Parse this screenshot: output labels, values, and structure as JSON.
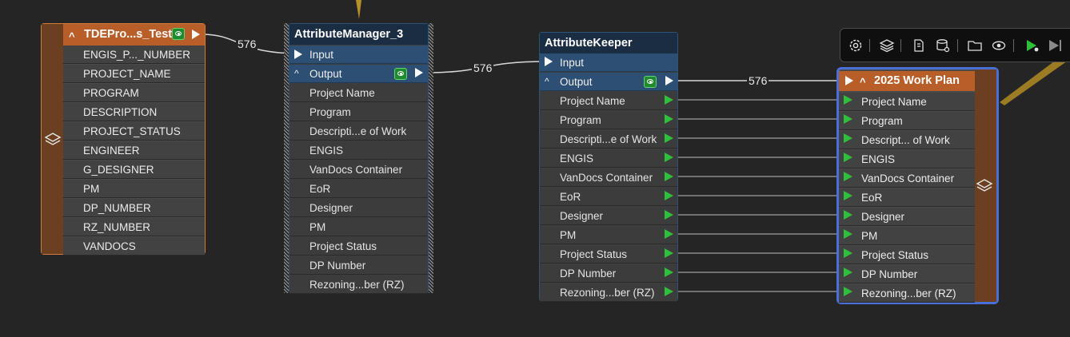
{
  "canvas": {
    "background": "#252526",
    "accent_orange": "#b85f29",
    "accent_blue": "#2c4f73",
    "accent_green": "#2fbf3a",
    "selection": "#4a6fd6"
  },
  "reader": {
    "title": "TDEPro...s_Test",
    "expand_glyph": "^",
    "attributes": [
      "ENGIS_P..._NUMBER",
      "PROJECT_NAME",
      "PROGRAM",
      "DESCRIPTION",
      "PROJECT_STATUS",
      "ENGINEER",
      "G_DESIGNER",
      "PM",
      "DP_NUMBER",
      "RZ_NUMBER",
      "VANDOCS"
    ]
  },
  "attribute_manager": {
    "title": "AttributeManager_3",
    "input_label": "Input",
    "output_label": "Output",
    "expand_glyph": "^",
    "attributes": [
      "Project Name",
      "Program",
      "Descripti...e of Work",
      "ENGIS",
      "VanDocs Container",
      "EoR",
      "Designer",
      "PM",
      "Project Status",
      "DP Number",
      "Rezoning...ber (RZ)"
    ]
  },
  "attribute_keeper": {
    "title": "AttributeKeeper",
    "input_label": "Input",
    "output_label": "Output",
    "expand_glyph": "^",
    "attributes": [
      "Project Name",
      "Program",
      "Descripti...e of Work",
      "ENGIS",
      "VanDocs Container",
      "EoR",
      "Designer",
      "PM",
      "Project Status",
      "DP Number",
      "Rezoning...ber (RZ)"
    ]
  },
  "writer": {
    "title": "2025 Work Plan",
    "expand_glyph": "^",
    "attributes": [
      "Project Name",
      "Program",
      "Descript... of Work",
      "ENGIS",
      "VanDocs Container",
      "EoR",
      "Designer",
      "PM",
      "Project Status",
      "DP Number",
      "Rezoning...ber (RZ)"
    ]
  },
  "connections": {
    "reader_to_manager": "576",
    "manager_to_keeper": "576",
    "keeper_to_writer": "576"
  },
  "toolbar": {
    "icons": [
      "gear-icon",
      "layers-icon",
      "reader-icon",
      "database-settings-icon",
      "folder-icon",
      "inspect-icon",
      "run-icon",
      "run-disabled-icon"
    ]
  }
}
